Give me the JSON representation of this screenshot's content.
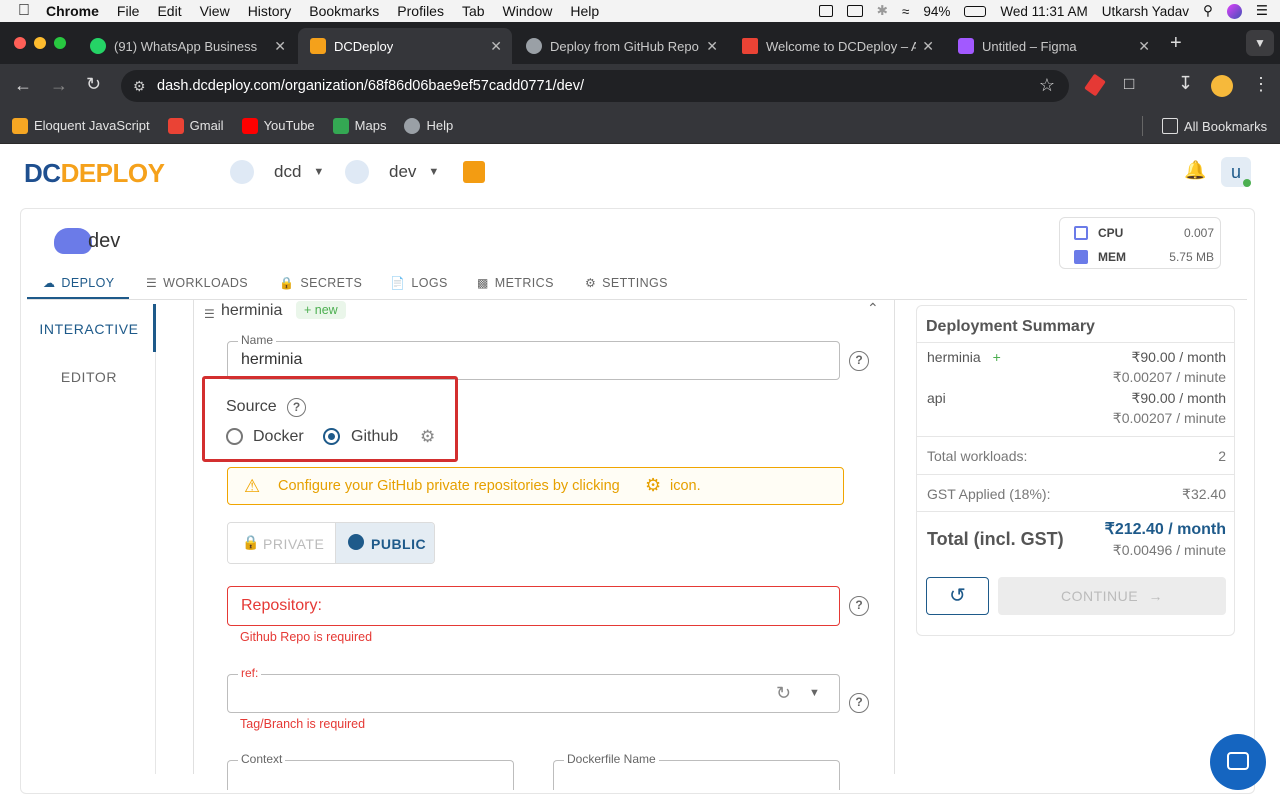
{
  "menubar": {
    "apple": "",
    "items": [
      "Chrome",
      "File",
      "Edit",
      "View",
      "History",
      "Bookmarks",
      "Profiles",
      "Tab",
      "Window",
      "Help"
    ],
    "battery": "94%",
    "clock": "Wed 11:31 AM",
    "user": "Utkarsh Yadav"
  },
  "tabs": [
    {
      "title": "(91) WhatsApp Business",
      "color": "#25d366"
    },
    {
      "title": "DCDeploy",
      "color": "#f5a11b"
    },
    {
      "title": "Deploy from GitHub Repo",
      "color": "#9aa0a6"
    },
    {
      "title": "Welcome to DCDeploy – A",
      "color": "#ea4335"
    },
    {
      "title": "Untitled – Figma",
      "color": "#a259ff"
    }
  ],
  "address": {
    "url": "dash.dcdeploy.com/organization/68f86d06bae9ef57cadd0771/dev/"
  },
  "bookmarks": {
    "items": [
      {
        "label": "Eloquent JavaScript",
        "color": "#f5a623"
      },
      {
        "label": "Gmail",
        "color": "#ea4335"
      },
      {
        "label": "YouTube",
        "color": "#ff0000"
      },
      {
        "label": "Maps",
        "color": "#34a853"
      },
      {
        "label": "Help",
        "color": "#9aa0a6"
      }
    ],
    "all": "All Bookmarks"
  },
  "header": {
    "logo_a": "DC",
    "logo_b": "DEPLOY",
    "org": "dcd",
    "env": "dev",
    "avatar": "u"
  },
  "env": {
    "title": "dev",
    "cpu_label": "CPU",
    "cpu_value": "0.007",
    "mem_label": "MEM",
    "mem_value": "5.75 MB"
  },
  "nav_tabs": [
    "DEPLOY",
    "WORKLOADS",
    "SECRETS",
    "LOGS",
    "METRICS",
    "SETTINGS"
  ],
  "left_nav": [
    "INTERACTIVE",
    "EDITOR"
  ],
  "workload": {
    "name": "herminia",
    "badge": "+ new",
    "name_label": "Name",
    "name_value": "herminia",
    "source_label": "Source",
    "source_docker": "Docker",
    "source_github": "Github",
    "source_selected": "Github",
    "warning": "Configure your GitHub private repositories by clicking",
    "warning_suffix": "icon.",
    "private_label": "PRIVATE",
    "public_label": "PUBLIC",
    "repo_label": "Repository:",
    "repo_error": "Github Repo is required",
    "ref_label": "ref:",
    "ref_error": "Tag/Branch is required",
    "context_label": "Context",
    "dockerfile_label": "Dockerfile Name"
  },
  "summary": {
    "title": "Deployment Summary",
    "items": [
      {
        "name": "herminia",
        "plus": "+",
        "month": "₹90.00 / month",
        "minute": "₹0.00207 / minute"
      },
      {
        "name": "api",
        "month": "₹90.00 / month",
        "minute": "₹0.00207 / minute"
      }
    ],
    "total_workloads_label": "Total workloads:",
    "total_workloads": "2",
    "gst_label": "GST Applied (18%):",
    "gst_value": "₹32.40",
    "total_label": "Total (incl. GST)",
    "total_month": "₹212.40 / month",
    "total_minute": "₹0.00496 / minute",
    "continue_label": "CONTINUE"
  },
  "colors": {
    "accent": "#1e5a8a",
    "error": "#e53935",
    "warning": "#f0a500",
    "highlight": "#d32f2f"
  }
}
